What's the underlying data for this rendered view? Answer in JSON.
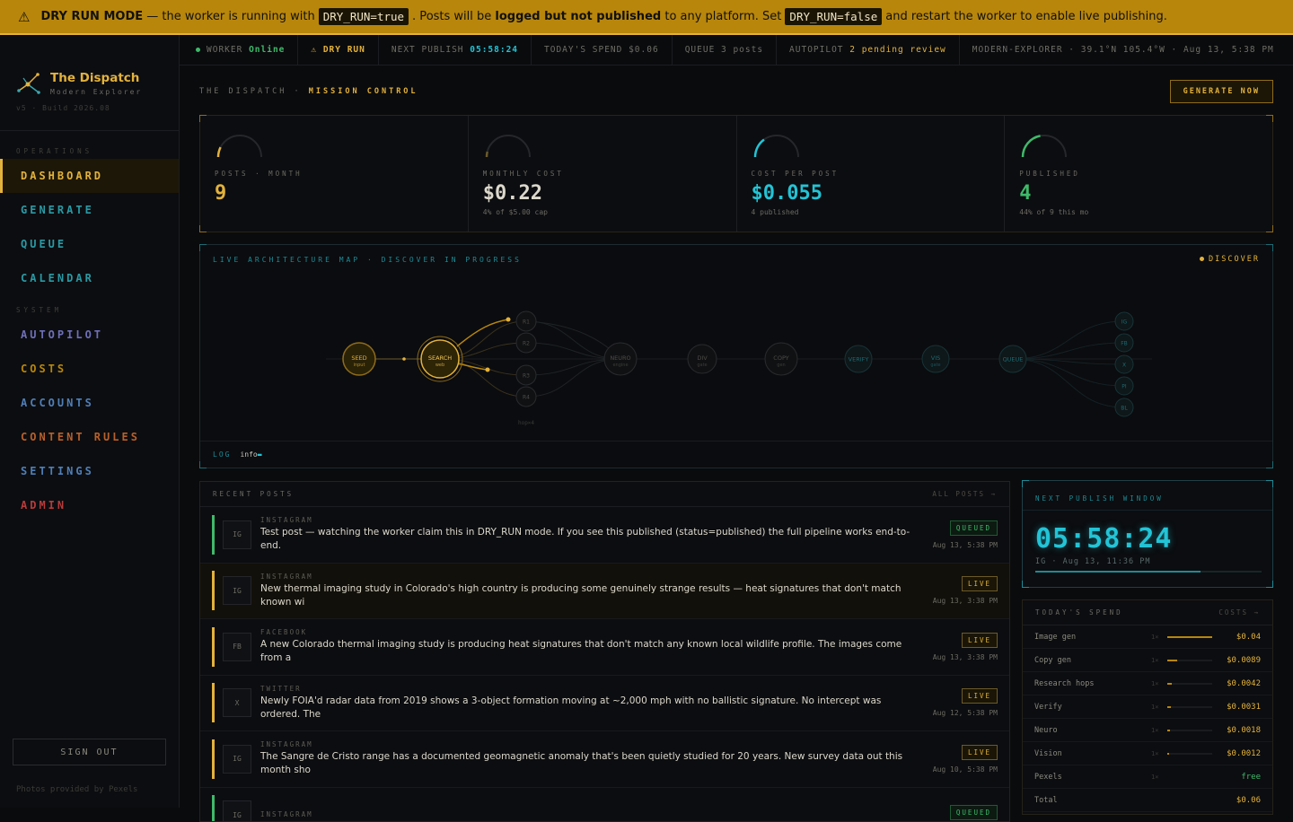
{
  "banner": {
    "mode": "DRY RUN MODE",
    "t1": "— the worker is running with",
    "code1": "DRY_RUN=true",
    "t2": ". Posts will be",
    "bold": "logged but not published",
    "t3": "to any platform. Set",
    "code2": "DRY_RUN=false",
    "t4": "and restart the worker to enable live publishing."
  },
  "brand": {
    "title": "The Dispatch",
    "subtitle": "Modern Explorer",
    "build": "v5 · Build 2026.08"
  },
  "sidebar": {
    "operations_label": "OPERATIONS",
    "system_label": "SYSTEM",
    "operations": [
      {
        "label": "DASHBOARD",
        "color": "#e3b23c",
        "active": true
      },
      {
        "label": "GENERATE",
        "color": "#2a9aa5"
      },
      {
        "label": "QUEUE",
        "color": "#2a9aa5"
      },
      {
        "label": "CALENDAR",
        "color": "#2a9aa5"
      }
    ],
    "system": [
      {
        "label": "AUTOPILOT",
        "color": "#6f6fb8"
      },
      {
        "label": "COSTS",
        "color": "#b8860b"
      },
      {
        "label": "ACCOUNTS",
        "color": "#4f7fb8"
      },
      {
        "label": "CONTENT RULES",
        "color": "#b8602b"
      },
      {
        "label": "SETTINGS",
        "color": "#4f7fb8"
      },
      {
        "label": "ADMIN",
        "color": "#b83b3b"
      }
    ],
    "signout": "SIGN OUT",
    "credit": "Photos provided by Pexels"
  },
  "statusbar": {
    "worker_label": "WORKER",
    "worker_value": "Online",
    "dry_run": "⚠ DRY RUN",
    "next_label": "NEXT PUBLISH",
    "next_value": "05:58:24",
    "spend": "TODAY'S SPEND $0.06",
    "queue": "QUEUE 3 posts",
    "autopilot_label": "AUTOPILOT",
    "autopilot_value": "2 pending review",
    "location": "MODERN-EXPLORER · 39.1°N 105.4°W · Aug 13, 5:38 PM"
  },
  "header": {
    "crumb_prefix": "THE DISPATCH ·",
    "crumb_page": "MISSION CONTROL",
    "generate": "GENERATE NOW"
  },
  "kpis": [
    {
      "label": "POSTS · MONTH",
      "value": "9",
      "sub": "",
      "color": "#e3b23c",
      "fill": 0.15
    },
    {
      "label": "MONTHLY COST",
      "value": "$0.22",
      "sub": "4% of $5.00 cap",
      "color": "#dcd8cc",
      "fill": 0.04,
      "gauge_color": "#6b5a2a"
    },
    {
      "label": "COST PER POST",
      "value": "$0.055",
      "sub": "4 published",
      "color": "#22c4d6",
      "fill": 0.3
    },
    {
      "label": "PUBLISHED",
      "value": "4",
      "sub": "44% of 9 this mo",
      "color": "#3fb96a",
      "fill": 0.44
    }
  ],
  "arch": {
    "title": "LIVE ARCHITECTURE MAP · DISCOVER IN PROGRESS",
    "badge": "DISCOVER",
    "log_label": "LOG",
    "log_value": "info",
    "hops_label": "hop×4",
    "nodes": [
      {
        "id": "seed",
        "label": "SEED",
        "sub": "input",
        "state": "done"
      },
      {
        "id": "search",
        "label": "SEARCH",
        "sub": "web",
        "state": "active"
      },
      {
        "id": "r1",
        "label": "R1"
      },
      {
        "id": "r2",
        "label": "R2"
      },
      {
        "id": "r3",
        "label": "R3"
      },
      {
        "id": "r4",
        "label": "R4"
      },
      {
        "id": "neuro",
        "label": "NEURO",
        "sub": "engine"
      },
      {
        "id": "div",
        "label": "DIV",
        "sub": "gate"
      },
      {
        "id": "copy",
        "label": "COPY",
        "sub": "gen"
      },
      {
        "id": "verify",
        "label": "VERIFY"
      },
      {
        "id": "vis",
        "label": "VIS",
        "sub": "gate"
      },
      {
        "id": "queue",
        "label": "QUEUE"
      },
      {
        "id": "ig",
        "label": "IG"
      },
      {
        "id": "fb",
        "label": "FB"
      },
      {
        "id": "x",
        "label": "X"
      },
      {
        "id": "pi",
        "label": "PI"
      },
      {
        "id": "bl",
        "label": "BL"
      }
    ]
  },
  "recent": {
    "title": "RECENT POSTS",
    "link": "ALL POSTS →",
    "posts": [
      {
        "icon": "IG",
        "platform": "INSTAGRAM",
        "text": "Test post — watching the worker claim this in DRY_RUN mode. If you see this published (status=published) the full pipeline works end-to-end.",
        "status": "QUEUED",
        "date": "Aug 13, 5:38 PM",
        "color": "#3fb96a"
      },
      {
        "icon": "IG",
        "platform": "INSTAGRAM",
        "text": "New thermal imaging study in Colorado's high country is producing some genuinely strange results — heat signatures that don't match known wi",
        "status": "LIVE",
        "date": "Aug 13, 3:38 PM",
        "color": "#e3b23c",
        "hi": true
      },
      {
        "icon": "FB",
        "platform": "FACEBOOK",
        "text": "A new Colorado thermal imaging study is producing heat signatures that don't match any known local wildlife profile. The images come from a",
        "status": "LIVE",
        "date": "Aug 13, 3:38 PM",
        "color": "#e3b23c"
      },
      {
        "icon": "X",
        "platform": "TWITTER",
        "text": "Newly FOIA'd radar data from 2019 shows a 3-object formation moving at ~2,000 mph with no ballistic signature. No intercept was ordered. The",
        "status": "LIVE",
        "date": "Aug 12, 5:38 PM",
        "color": "#e3b23c"
      },
      {
        "icon": "IG",
        "platform": "INSTAGRAM",
        "text": "The Sangre de Cristo range has a documented geomagnetic anomaly that's been quietly studied for 20 years. New survey data out this month sho",
        "status": "LIVE",
        "date": "Aug 10, 5:38 PM",
        "color": "#e3b23c"
      },
      {
        "icon": "IG",
        "platform": "INSTAGRAM",
        "text": "",
        "status": "QUEUED",
        "date": "",
        "color": "#3fb96a"
      }
    ]
  },
  "next_window": {
    "title": "NEXT PUBLISH WINDOW",
    "time": "05:58:24",
    "sub": "IG · Aug 13, 11:36 PM",
    "progress": 0.73
  },
  "spend": {
    "title": "TODAY'S SPEND",
    "link": "COSTS →",
    "rows": [
      {
        "name": "Image gen",
        "x": "1×",
        "val": "$0.04",
        "fill": 1.0
      },
      {
        "name": "Copy gen",
        "x": "1×",
        "val": "$0.0089",
        "fill": 0.22
      },
      {
        "name": "Research hops",
        "x": "1×",
        "val": "$0.0042",
        "fill": 0.1
      },
      {
        "name": "Verify",
        "x": "1×",
        "val": "$0.0031",
        "fill": 0.08
      },
      {
        "name": "Neuro",
        "x": "1×",
        "val": "$0.0018",
        "fill": 0.05
      },
      {
        "name": "Vision",
        "x": "1×",
        "val": "$0.0012",
        "fill": 0.03
      },
      {
        "name": "Pexels",
        "x": "1×",
        "val": "free",
        "fill": 0
      },
      {
        "name": "Total",
        "x": "",
        "val": "$0.06",
        "fill": 0
      }
    ]
  }
}
